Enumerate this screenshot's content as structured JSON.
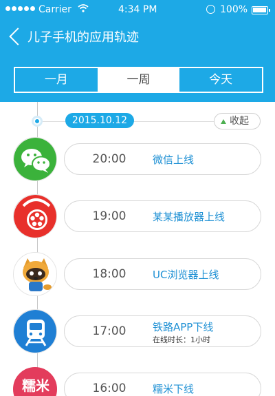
{
  "status_bar": {
    "carrier": "Carrier",
    "time": "4:34 PM",
    "battery": "100%"
  },
  "header": {
    "title": "儿子手机的应用轨迹"
  },
  "segments": [
    "一月",
    "一周",
    "今天"
  ],
  "selected_segment": 1,
  "date": "2015.10.12",
  "collapse_label": "收起",
  "events": [
    {
      "time": "20:00",
      "label": "微信上线",
      "icon": "wechat-icon"
    },
    {
      "time": "19:00",
      "label": "某某播放器上线",
      "icon": "video-player-icon"
    },
    {
      "time": "18:00",
      "label": "UC浏览器上线",
      "icon": "uc-browser-icon"
    },
    {
      "time": "17:00",
      "label": "铁路APP下线",
      "detail": "在线时长：1小时",
      "icon": "railway-icon"
    },
    {
      "time": "16:00",
      "label": "糯米下线",
      "icon": "nuomi-icon",
      "icon_text": "糯米"
    }
  ],
  "colors": {
    "accent": "#1da9e6",
    "link": "#1e90d4",
    "wechat": "#3bb23b",
    "player": "#e8302b",
    "railway": "#1f7fd4",
    "nuomi": "#e33c5c"
  }
}
